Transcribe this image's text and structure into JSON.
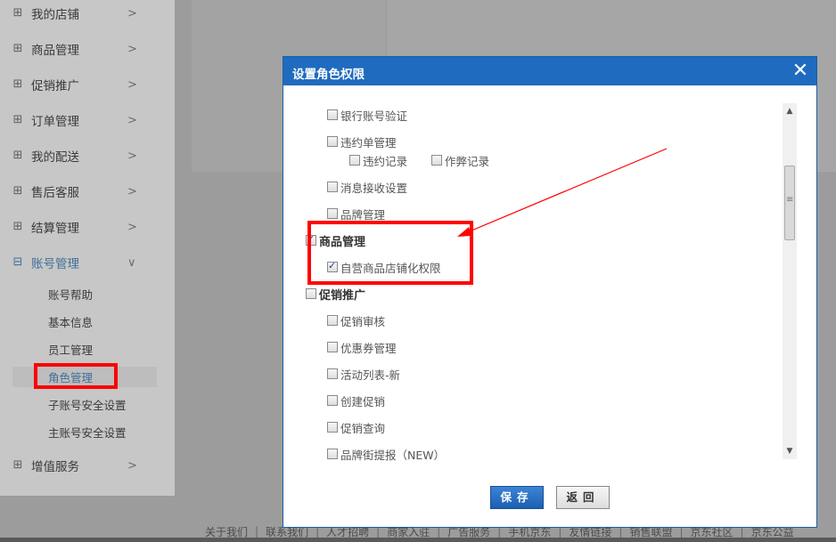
{
  "sidebar": {
    "items": [
      {
        "label": "我的店铺"
      },
      {
        "label": "商品管理"
      },
      {
        "label": "促销推广"
      },
      {
        "label": "订单管理"
      },
      {
        "label": "我的配送"
      },
      {
        "label": "售后客服"
      },
      {
        "label": "结算管理"
      },
      {
        "label": "账号管理"
      },
      {
        "label": "增值服务"
      }
    ],
    "sub_items": [
      {
        "label": "账号帮助"
      },
      {
        "label": "基本信息"
      },
      {
        "label": "员工管理"
      },
      {
        "label": "角色管理"
      },
      {
        "label": "子账号安全设置"
      },
      {
        "label": "主账号安全设置"
      }
    ],
    "plus_glyph": "⊞",
    "minus_glyph": "⊟",
    "chevron_glyph": ">",
    "chevron_down_glyph": "∨"
  },
  "dialog": {
    "title": "设置角色权限",
    "close_glyph": "✕",
    "perm": {
      "bank": "银行账号验证",
      "violation": "违约单管理",
      "violation_record": "违约记录",
      "cheat_record": "作弊记录",
      "message": "消息接收设置",
      "brand": "品牌管理",
      "goods": "商品管理",
      "self_shop": "自营商品店铺化权限",
      "promo": "促销推广",
      "promo_review": "促销审核",
      "coupon": "优惠券管理",
      "activity_list": "活动列表-新",
      "create_promo": "创建促销",
      "promo_query": "促销查询",
      "brand_street": "品牌街提报（NEW）"
    },
    "save_label": "保存",
    "back_label": "返回"
  },
  "footer": {
    "links": [
      "关于我们",
      "联系我们",
      "人才招聘",
      "商家入驻",
      "广告服务",
      "手机京东",
      "友情链接",
      "销售联盟",
      "京东社区",
      "京东公益"
    ]
  },
  "colors": {
    "highlight": "#ff0000",
    "dialog_header": "#1f6bbf"
  }
}
